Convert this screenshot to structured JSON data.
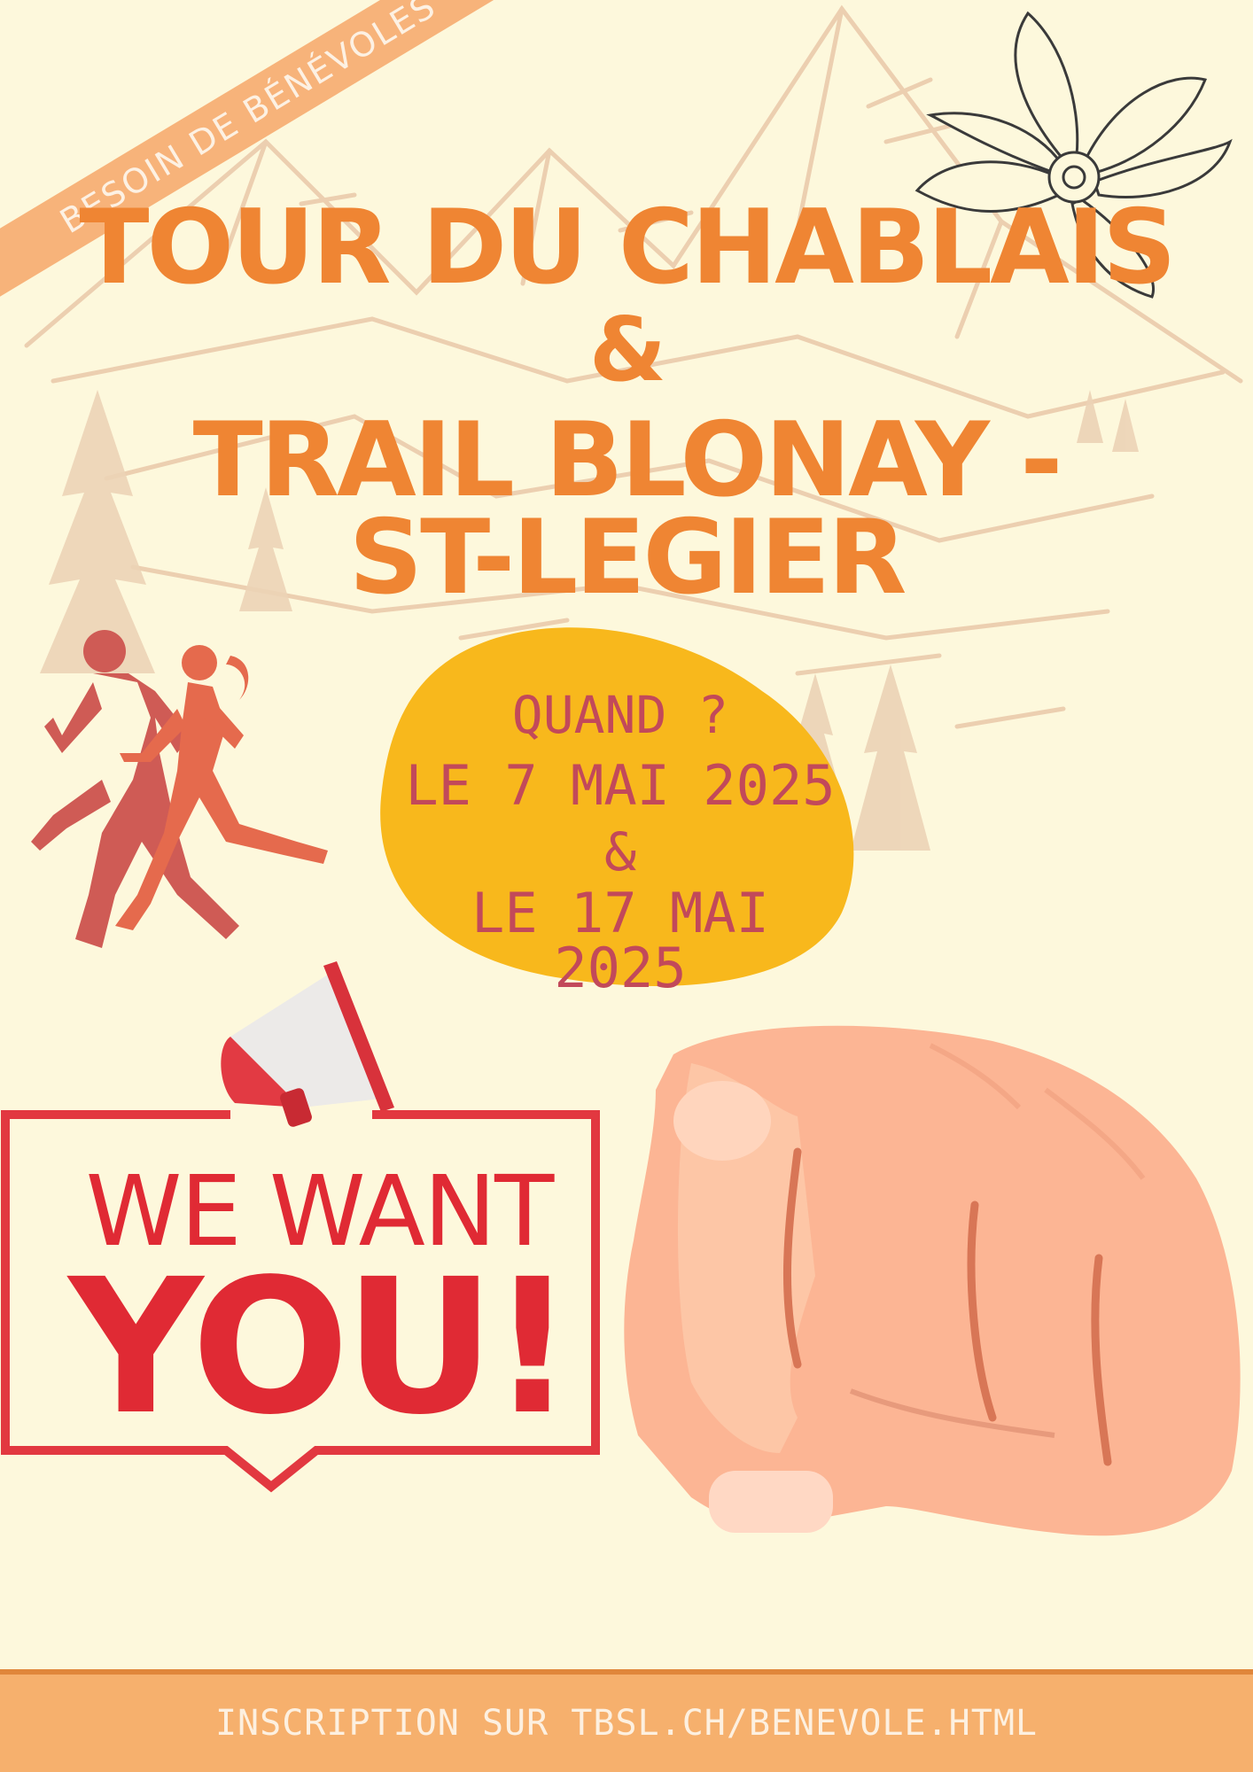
{
  "ribbon": {
    "text": "BESOIN DE BÉNÉVOLES"
  },
  "title": {
    "line1": "TOUR DU CHABLAIS",
    "line2": "&",
    "line3": "TRAIL BLONAY -",
    "line4": "ST-LEGIER"
  },
  "dates": {
    "line1": "QUAND ?",
    "line2": "LE 7 MAI 2025",
    "line3": "&",
    "line4": "LE 17 MAI 2025"
  },
  "callout": {
    "line1": "WE WANT",
    "line2": "YOU!"
  },
  "footer": {
    "text": "INSCRIPTION SUR TBSL.CH/BENEVOLE.HTML"
  },
  "colors": {
    "background": "#fdf8dc",
    "title": "#ef8533",
    "blob": "#f8b81c",
    "date_text": "#c2495a",
    "callout_red": "#e02a34",
    "footer": "#f6b06d"
  },
  "icons": [
    "mountain-illustration",
    "flower-icon",
    "runners-silhouette",
    "megaphone-icon",
    "pointing-hand"
  ]
}
